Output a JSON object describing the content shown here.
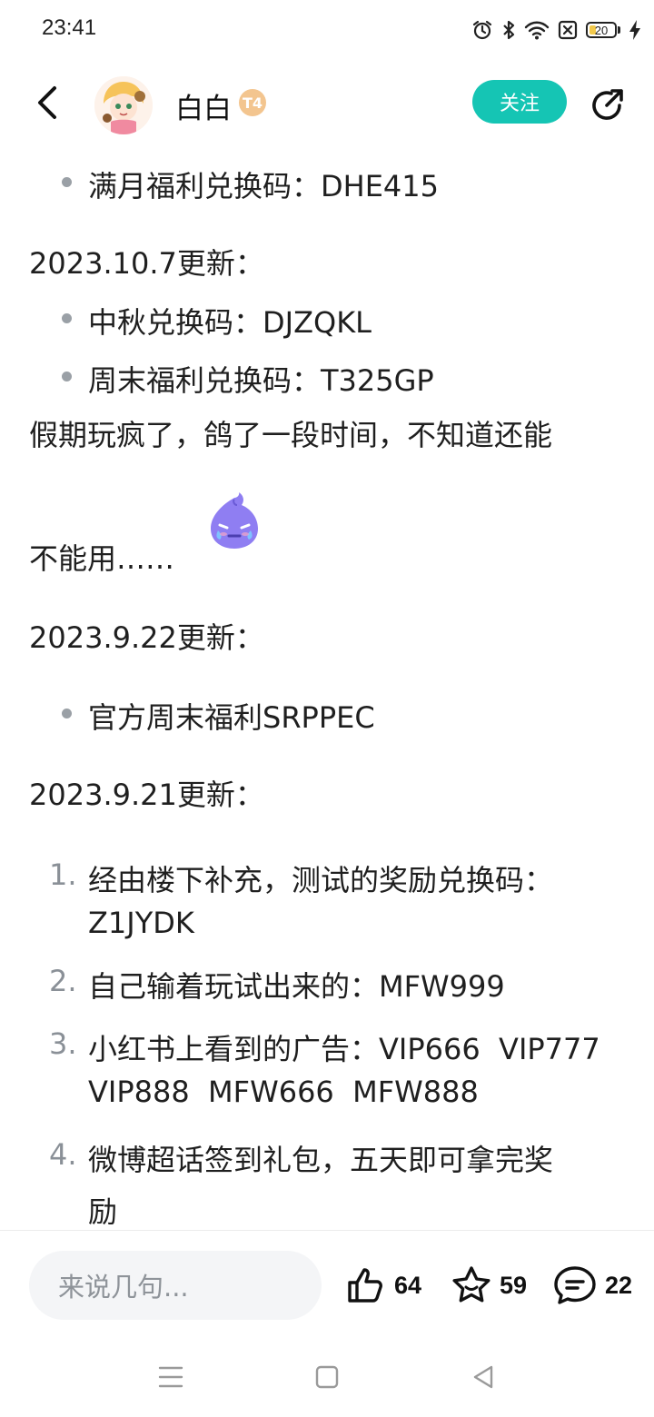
{
  "status_bar": {
    "time": "23:41",
    "battery_level": "20",
    "icons": [
      "alarm-icon",
      "bluetooth-icon",
      "wifi-icon",
      "sim-off-icon",
      "battery-icon",
      "charging-icon"
    ]
  },
  "header": {
    "author_name": "白白",
    "level_badge": "T4",
    "follow_label": "关注",
    "icons": [
      "back-icon",
      "share-icon"
    ]
  },
  "post": {
    "line_monthly": "满月福利兑换码：DHE415",
    "update_1007": "2023.10.7更新：",
    "line_midautumn": "中秋兑换码：DJZQKL",
    "line_weekend": "周末福利兑换码：T325GP",
    "holiday_line1": "假期玩疯了，鸽了一段时间，不知道还能",
    "holiday_line2": "不能用……",
    "update_0922": "2023.9.22更新：",
    "line_official": "官方周末福利SRPPEC",
    "update_0921": "2023.9.21更新：",
    "list": [
      {
        "num": "1.",
        "line1": "经由楼下补充，测试的奖励兑换码：",
        "line2": "Z1JYDK"
      },
      {
        "num": "2.",
        "line1": "自己输着玩试出来的：MFW999"
      },
      {
        "num": "3.",
        "line1": "小红书上看到的广告：VIP666  VIP777",
        "line2": "VIP888  MFW666  MFW888"
      },
      {
        "num": "4.",
        "line1": "微博超话签到礼包，五天即可拿完奖",
        "line2": "励"
      }
    ]
  },
  "bottom": {
    "comment_placeholder": "来说几句...",
    "like_count": "64",
    "favorite_count": "59",
    "comment_count": "22"
  },
  "colors": {
    "accent": "#15c5b4",
    "bullet": "#9aa0a6",
    "text": "#1f1f1f"
  }
}
